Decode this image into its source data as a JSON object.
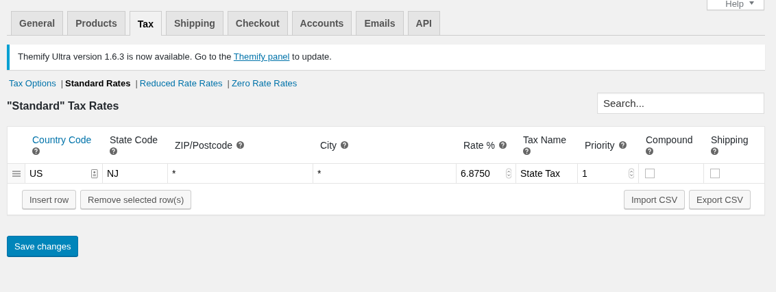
{
  "help_button": {
    "label": "Help"
  },
  "tabs": [
    {
      "label": "General",
      "selected": false
    },
    {
      "label": "Products",
      "selected": false
    },
    {
      "label": "Tax",
      "selected": true
    },
    {
      "label": "Shipping",
      "selected": false
    },
    {
      "label": "Checkout",
      "selected": false
    },
    {
      "label": "Accounts",
      "selected": false
    },
    {
      "label": "Emails",
      "selected": false
    },
    {
      "label": "API",
      "selected": false
    }
  ],
  "notice": {
    "before": "Themify Ultra version 1.6.3 is now available. Go to the",
    "link": "Themify panel",
    "after": "to update."
  },
  "subnav": [
    {
      "label": "Tax Options",
      "selected": false
    },
    {
      "separator": "|",
      "label": "Standard Rates",
      "selected": true
    },
    {
      "separator": "|",
      "label": "Reduced Rate Rates",
      "selected": false
    },
    {
      "separator": "|",
      "label": "Zero Rate Rates",
      "selected": false
    }
  ],
  "heading": "\"Standard\" Tax Rates",
  "search": {
    "placeholder": "Search..."
  },
  "table": {
    "columns": [
      {
        "label": "Country Code",
        "kind": "link"
      },
      {
        "label": "State Code",
        "kind": "text"
      },
      {
        "label": "ZIP/Postcode",
        "kind": "text"
      },
      {
        "label": "City",
        "kind": "text"
      },
      {
        "label": "Rate %",
        "kind": "text"
      },
      {
        "label": "Tax Name",
        "kind": "text"
      },
      {
        "label": "Priority",
        "kind": "text"
      },
      {
        "label": "Compound",
        "kind": "text"
      },
      {
        "label": "Shipping",
        "kind": "text"
      }
    ],
    "rows": [
      {
        "cells": [
          {
            "kind": "lookup",
            "value": "US"
          },
          {
            "kind": "text",
            "value": "NJ"
          },
          {
            "kind": "text",
            "value": "*"
          },
          {
            "kind": "text",
            "value": "*"
          },
          {
            "kind": "number",
            "value": "6.8750"
          },
          {
            "kind": "text",
            "value": "State Tax"
          },
          {
            "kind": "number",
            "value": "1"
          },
          {
            "kind": "check",
            "checked": false
          },
          {
            "kind": "check",
            "checked": false
          }
        ]
      }
    ],
    "left_buttons": [
      "Insert row",
      "Remove selected row(s)"
    ],
    "right_buttons": [
      "Import CSV",
      "Export CSV"
    ]
  },
  "save_button": "Save changes"
}
